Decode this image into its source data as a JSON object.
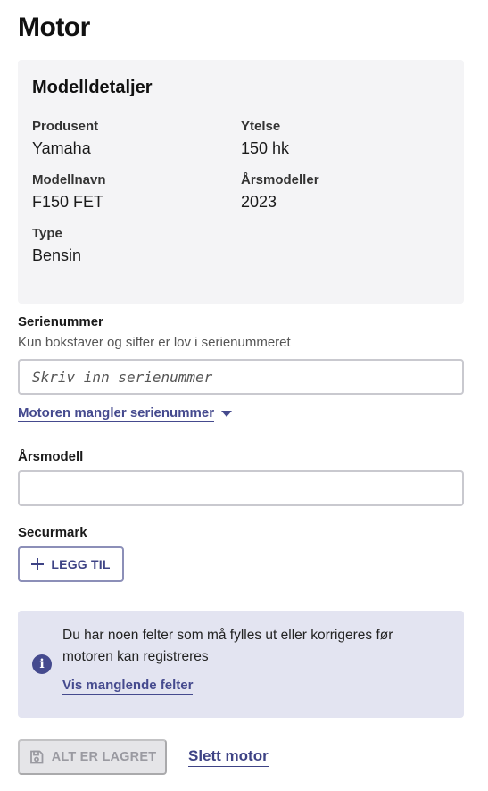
{
  "page": {
    "title": "Motor"
  },
  "model_details": {
    "title": "Modelldetaljer",
    "fields": [
      {
        "label": "Produsent",
        "value": "Yamaha"
      },
      {
        "label": "Ytelse",
        "value": "150 hk"
      },
      {
        "label": "Modellnavn",
        "value": "F150 FET"
      },
      {
        "label": "Årsmodeller",
        "value": "2023"
      },
      {
        "label": "Type",
        "value": "Bensin"
      }
    ]
  },
  "serial": {
    "label": "Serienummer",
    "hint": "Kun bokstaver og siffer er lov i serienummeret",
    "value": "",
    "placeholder": "Skriv inn serienummer",
    "missing_toggle": "Motoren mangler serienummer"
  },
  "year": {
    "label": "Årsmodell",
    "value": ""
  },
  "securmark": {
    "label": "Securmark",
    "add_label": "LEGG TIL"
  },
  "info": {
    "message": "Du har noen felter som må fylles ut eller korrigeres før motoren kan registreres",
    "link": "Vis manglende felter"
  },
  "actions": {
    "saved_label": "ALT ER LAGRET",
    "delete_label": "Slett motor"
  },
  "colors": {
    "accent": "#454a8e",
    "card_bg": "#f4f4f6",
    "info_bg": "#e3e4f1",
    "disabled_bg": "#e5e5e8"
  },
  "icons": {
    "add": "plus-icon",
    "info": "info-icon",
    "saved": "save-icon",
    "toggle": "chevron-down-icon"
  }
}
